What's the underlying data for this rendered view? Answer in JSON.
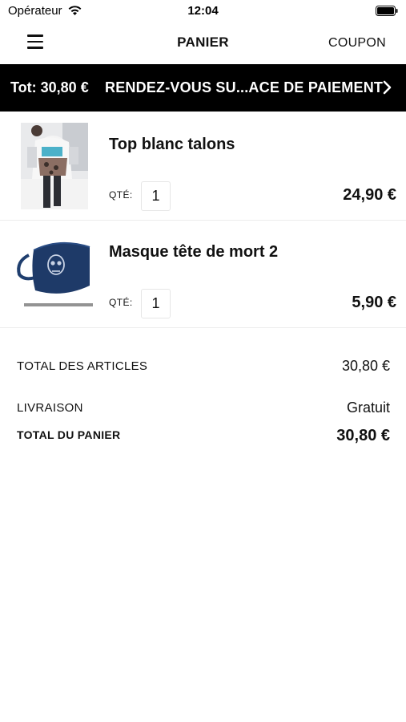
{
  "status_bar": {
    "carrier": "Opérateur",
    "time": "12:04"
  },
  "nav": {
    "title": "PANIER",
    "coupon_label": "COUPON"
  },
  "checkout_bar": {
    "total": "Tot: 30,80 €",
    "cta": "RENDEZ-VOUS SU...ACE DE PAIEMENT",
    "background": "#000000",
    "text_color": "#ffffff"
  },
  "cart": {
    "qty_label": "QTÉ:",
    "items": [
      {
        "name": "Top blanc talons",
        "qty": "1",
        "price": "24,90 €",
        "image_icon": "product-photo-top"
      },
      {
        "name": "Masque tête de mort 2",
        "qty": "1",
        "price": "5,90 €",
        "image_icon": "product-photo-mask"
      }
    ]
  },
  "summary": {
    "items_label": "TOTAL DES ARTICLES",
    "items_value": "30,80 €",
    "delivery_label": "LIVRAISON",
    "delivery_value": "Gratuit",
    "total_label": "TOTAL DU PANIER",
    "total_value": "30,80 €"
  }
}
